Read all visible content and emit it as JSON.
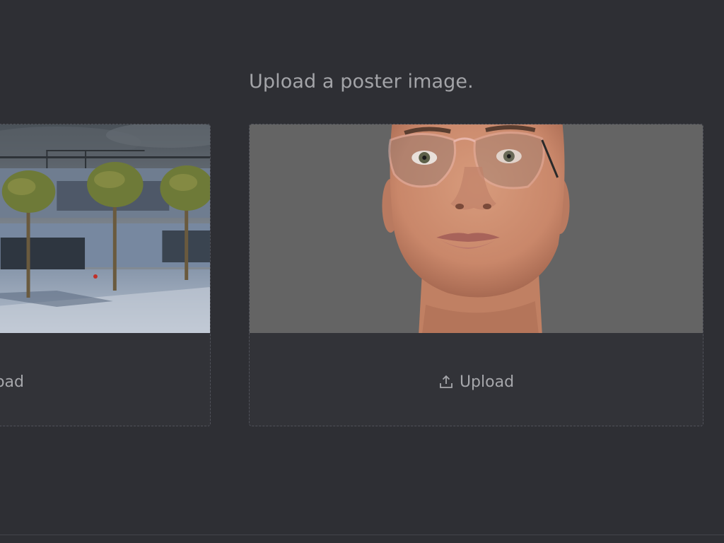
{
  "heading": "Upload a poster image.",
  "cards": [
    {
      "image_alt": "Modern house with palm trees",
      "upload_label": "Upload",
      "upload_icon": "upload-icon"
    },
    {
      "image_alt": "3D female head wearing aviator glasses",
      "upload_label": "Upload",
      "upload_icon": "upload-icon"
    }
  ],
  "colors": {
    "background": "#2e2f34",
    "card_background": "#323338",
    "dashed_border": "#50525a",
    "text": "#a6a7ab"
  }
}
